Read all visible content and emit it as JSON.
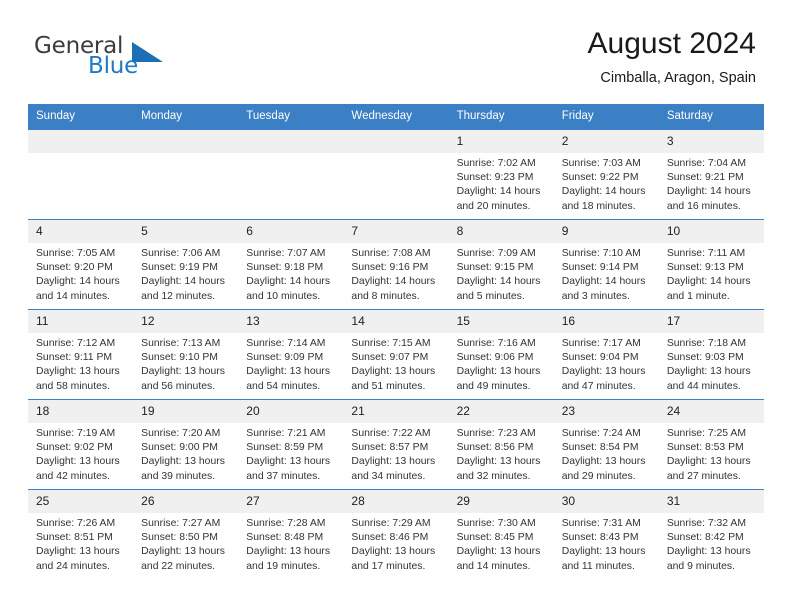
{
  "brand": {
    "name_top": "General",
    "name_bottom": "Blue"
  },
  "header": {
    "title": "August 2024",
    "subtitle": "Cimballa, Aragon, Spain"
  },
  "colors": {
    "header_blue": "#3b7fc4",
    "brand_blue": "#2079c4",
    "daynum_band": "#f0f0f0"
  },
  "weekdays": [
    "Sunday",
    "Monday",
    "Tuesday",
    "Wednesday",
    "Thursday",
    "Friday",
    "Saturday"
  ],
  "labels": {
    "sunrise": "Sunrise:",
    "sunset": "Sunset:",
    "daylight": "Daylight:"
  },
  "weeks": [
    [
      {
        "day": "",
        "empty": true
      },
      {
        "day": "",
        "empty": true
      },
      {
        "day": "",
        "empty": true
      },
      {
        "day": "",
        "empty": true
      },
      {
        "day": "1",
        "sunrise": "Sunrise: 7:02 AM",
        "sunset": "Sunset: 9:23 PM",
        "daylight": "Daylight: 14 hours and 20 minutes."
      },
      {
        "day": "2",
        "sunrise": "Sunrise: 7:03 AM",
        "sunset": "Sunset: 9:22 PM",
        "daylight": "Daylight: 14 hours and 18 minutes."
      },
      {
        "day": "3",
        "sunrise": "Sunrise: 7:04 AM",
        "sunset": "Sunset: 9:21 PM",
        "daylight": "Daylight: 14 hours and 16 minutes."
      }
    ],
    [
      {
        "day": "4",
        "sunrise": "Sunrise: 7:05 AM",
        "sunset": "Sunset: 9:20 PM",
        "daylight": "Daylight: 14 hours and 14 minutes."
      },
      {
        "day": "5",
        "sunrise": "Sunrise: 7:06 AM",
        "sunset": "Sunset: 9:19 PM",
        "daylight": "Daylight: 14 hours and 12 minutes."
      },
      {
        "day": "6",
        "sunrise": "Sunrise: 7:07 AM",
        "sunset": "Sunset: 9:18 PM",
        "daylight": "Daylight: 14 hours and 10 minutes."
      },
      {
        "day": "7",
        "sunrise": "Sunrise: 7:08 AM",
        "sunset": "Sunset: 9:16 PM",
        "daylight": "Daylight: 14 hours and 8 minutes."
      },
      {
        "day": "8",
        "sunrise": "Sunrise: 7:09 AM",
        "sunset": "Sunset: 9:15 PM",
        "daylight": "Daylight: 14 hours and 5 minutes."
      },
      {
        "day": "9",
        "sunrise": "Sunrise: 7:10 AM",
        "sunset": "Sunset: 9:14 PM",
        "daylight": "Daylight: 14 hours and 3 minutes."
      },
      {
        "day": "10",
        "sunrise": "Sunrise: 7:11 AM",
        "sunset": "Sunset: 9:13 PM",
        "daylight": "Daylight: 14 hours and 1 minute."
      }
    ],
    [
      {
        "day": "11",
        "sunrise": "Sunrise: 7:12 AM",
        "sunset": "Sunset: 9:11 PM",
        "daylight": "Daylight: 13 hours and 58 minutes."
      },
      {
        "day": "12",
        "sunrise": "Sunrise: 7:13 AM",
        "sunset": "Sunset: 9:10 PM",
        "daylight": "Daylight: 13 hours and 56 minutes."
      },
      {
        "day": "13",
        "sunrise": "Sunrise: 7:14 AM",
        "sunset": "Sunset: 9:09 PM",
        "daylight": "Daylight: 13 hours and 54 minutes."
      },
      {
        "day": "14",
        "sunrise": "Sunrise: 7:15 AM",
        "sunset": "Sunset: 9:07 PM",
        "daylight": "Daylight: 13 hours and 51 minutes."
      },
      {
        "day": "15",
        "sunrise": "Sunrise: 7:16 AM",
        "sunset": "Sunset: 9:06 PM",
        "daylight": "Daylight: 13 hours and 49 minutes."
      },
      {
        "day": "16",
        "sunrise": "Sunrise: 7:17 AM",
        "sunset": "Sunset: 9:04 PM",
        "daylight": "Daylight: 13 hours and 47 minutes."
      },
      {
        "day": "17",
        "sunrise": "Sunrise: 7:18 AM",
        "sunset": "Sunset: 9:03 PM",
        "daylight": "Daylight: 13 hours and 44 minutes."
      }
    ],
    [
      {
        "day": "18",
        "sunrise": "Sunrise: 7:19 AM",
        "sunset": "Sunset: 9:02 PM",
        "daylight": "Daylight: 13 hours and 42 minutes."
      },
      {
        "day": "19",
        "sunrise": "Sunrise: 7:20 AM",
        "sunset": "Sunset: 9:00 PM",
        "daylight": "Daylight: 13 hours and 39 minutes."
      },
      {
        "day": "20",
        "sunrise": "Sunrise: 7:21 AM",
        "sunset": "Sunset: 8:59 PM",
        "daylight": "Daylight: 13 hours and 37 minutes."
      },
      {
        "day": "21",
        "sunrise": "Sunrise: 7:22 AM",
        "sunset": "Sunset: 8:57 PM",
        "daylight": "Daylight: 13 hours and 34 minutes."
      },
      {
        "day": "22",
        "sunrise": "Sunrise: 7:23 AM",
        "sunset": "Sunset: 8:56 PM",
        "daylight": "Daylight: 13 hours and 32 minutes."
      },
      {
        "day": "23",
        "sunrise": "Sunrise: 7:24 AM",
        "sunset": "Sunset: 8:54 PM",
        "daylight": "Daylight: 13 hours and 29 minutes."
      },
      {
        "day": "24",
        "sunrise": "Sunrise: 7:25 AM",
        "sunset": "Sunset: 8:53 PM",
        "daylight": "Daylight: 13 hours and 27 minutes."
      }
    ],
    [
      {
        "day": "25",
        "sunrise": "Sunrise: 7:26 AM",
        "sunset": "Sunset: 8:51 PM",
        "daylight": "Daylight: 13 hours and 24 minutes."
      },
      {
        "day": "26",
        "sunrise": "Sunrise: 7:27 AM",
        "sunset": "Sunset: 8:50 PM",
        "daylight": "Daylight: 13 hours and 22 minutes."
      },
      {
        "day": "27",
        "sunrise": "Sunrise: 7:28 AM",
        "sunset": "Sunset: 8:48 PM",
        "daylight": "Daylight: 13 hours and 19 minutes."
      },
      {
        "day": "28",
        "sunrise": "Sunrise: 7:29 AM",
        "sunset": "Sunset: 8:46 PM",
        "daylight": "Daylight: 13 hours and 17 minutes."
      },
      {
        "day": "29",
        "sunrise": "Sunrise: 7:30 AM",
        "sunset": "Sunset: 8:45 PM",
        "daylight": "Daylight: 13 hours and 14 minutes."
      },
      {
        "day": "30",
        "sunrise": "Sunrise: 7:31 AM",
        "sunset": "Sunset: 8:43 PM",
        "daylight": "Daylight: 13 hours and 11 minutes."
      },
      {
        "day": "31",
        "sunrise": "Sunrise: 7:32 AM",
        "sunset": "Sunset: 8:42 PM",
        "daylight": "Daylight: 13 hours and 9 minutes."
      }
    ]
  ]
}
